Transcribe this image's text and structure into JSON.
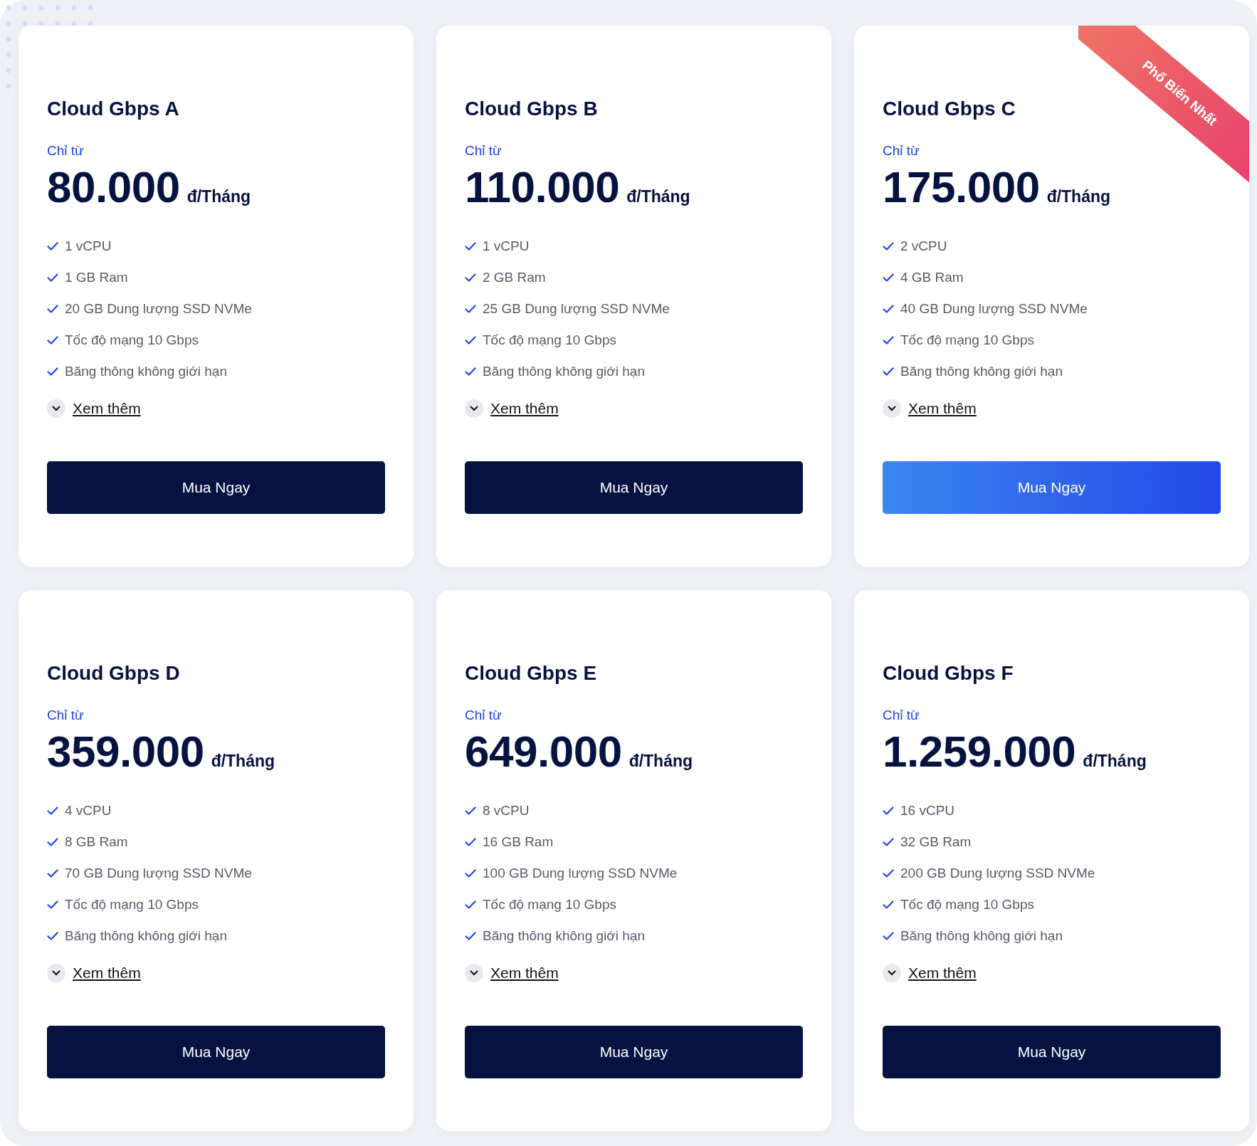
{
  "plans": [
    {
      "name": "Cloud Gbps A",
      "from_label": "Chỉ từ",
      "price": "80.000",
      "unit": "đ/Tháng",
      "features": [
        "1 vCPU",
        "1 GB Ram",
        "20 GB Dung lượng SSD NVMe",
        "Tốc độ mạng 10 Gbps",
        "Băng thông không giới hạn"
      ],
      "more_label": "Xem thêm",
      "button": "Mua Ngay",
      "featured": false
    },
    {
      "name": "Cloud Gbps B",
      "from_label": "Chỉ từ",
      "price": "110.000",
      "unit": "đ/Tháng",
      "features": [
        "1 vCPU",
        "2 GB Ram",
        "25 GB Dung lượng SSD NVMe",
        "Tốc độ mạng 10 Gbps",
        "Băng thông không giới hạn"
      ],
      "more_label": "Xem thêm",
      "button": "Mua Ngay",
      "featured": false
    },
    {
      "name": "Cloud Gbps C",
      "from_label": "Chỉ từ",
      "price": "175.000",
      "unit": "đ/Tháng",
      "features": [
        "2 vCPU",
        "4 GB Ram",
        "40 GB Dung lượng SSD NVMe",
        "Tốc độ mạng 10 Gbps",
        "Băng thông không giới hạn"
      ],
      "more_label": "Xem thêm",
      "button": "Mua Ngay",
      "featured": true,
      "ribbon": "Phổ Biến Nhất"
    },
    {
      "name": "Cloud Gbps D",
      "from_label": "Chỉ từ",
      "price": "359.000",
      "unit": "đ/Tháng",
      "features": [
        "4 vCPU",
        "8 GB Ram",
        "70 GB Dung lượng SSD NVMe",
        "Tốc độ mạng 10 Gbps",
        "Băng thông không giới hạn"
      ],
      "more_label": "Xem thêm",
      "button": "Mua Ngay",
      "featured": false
    },
    {
      "name": "Cloud Gbps E",
      "from_label": "Chỉ từ",
      "price": "649.000",
      "unit": "đ/Tháng",
      "features": [
        "8 vCPU",
        "16 GB Ram",
        "100 GB Dung lượng SSD NVMe",
        "Tốc độ mạng 10 Gbps",
        "Băng thông không giới hạn"
      ],
      "more_label": "Xem thêm",
      "button": "Mua Ngay",
      "featured": false
    },
    {
      "name": "Cloud Gbps F",
      "from_label": "Chỉ từ",
      "price": "1.259.000",
      "unit": "đ/Tháng",
      "features": [
        "16 vCPU",
        "32 GB Ram",
        "200 GB Dung lượng SSD NVMe",
        "Tốc độ mạng 10 Gbps",
        "Băng thông không giới hạn"
      ],
      "more_label": "Xem thêm",
      "button": "Mua Ngay",
      "featured": false
    }
  ]
}
